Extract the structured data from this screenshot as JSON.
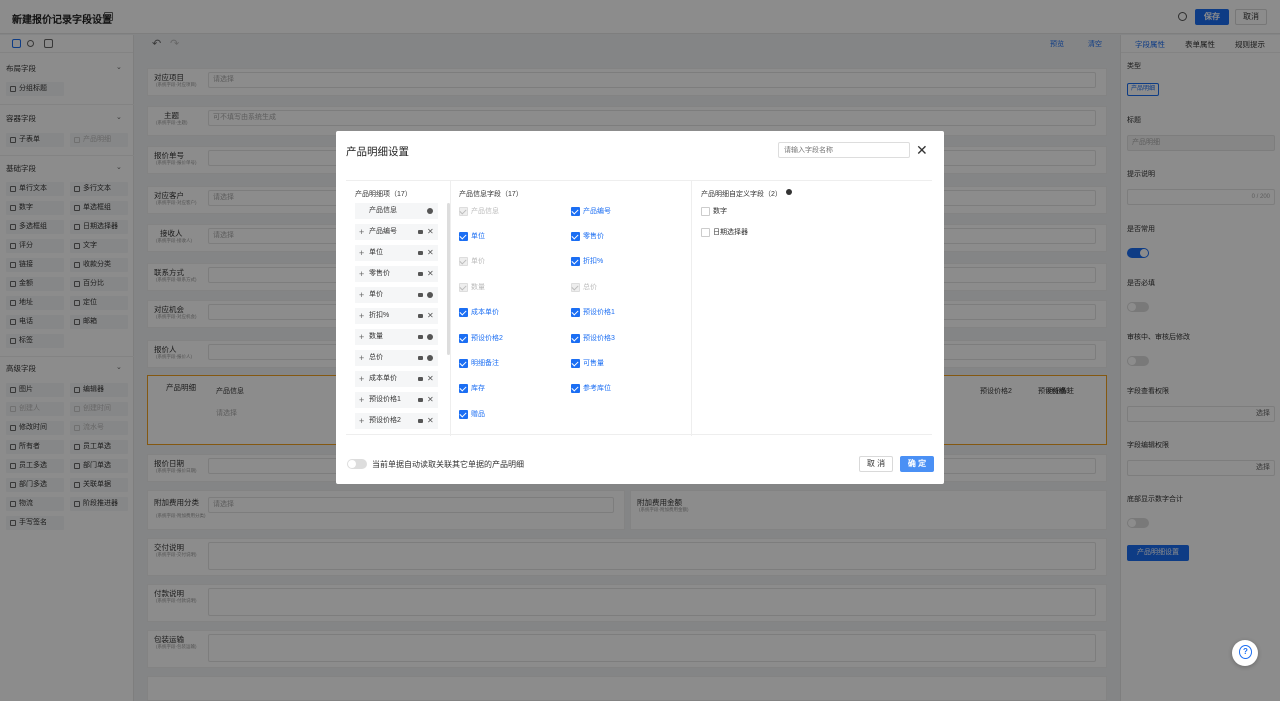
{
  "header": {
    "title": "新建报价记录字段设置",
    "save": "保存",
    "cancel": "取消"
  },
  "left": {
    "layout_title": "布局字段",
    "layout_items": [
      "分组标题"
    ],
    "container_title": "容器字段",
    "container_items": [
      "子表单",
      "产品明细"
    ],
    "basic_title": "基础字段",
    "basic_items": [
      "单行文本",
      "多行文本",
      "数字",
      "单选框组",
      "多选框组",
      "日期选择器",
      "评分",
      "文字",
      "链接",
      "收款分类",
      "金额",
      "百分比",
      "地址",
      "定位",
      "电话",
      "邮箱",
      "标签"
    ],
    "adv_title": "高级字段",
    "adv_items": [
      "图片",
      "编辑器",
      "创建人",
      "创建时间",
      "修改时间",
      "流水号",
      "所有者",
      "员工单选",
      "员工多选",
      "部门单选",
      "部门多选",
      "关联单据",
      "物流",
      "阶段推进器",
      "手写签名"
    ]
  },
  "form": {
    "rows": [
      {
        "label": "对应项目",
        "sub": "(系统字段-对应项目)",
        "value": "请选择"
      },
      {
        "label": "主题",
        "sub": "(系统字段-主题)",
        "value": "可不填写由系统生成"
      },
      {
        "label": "报价单号",
        "sub": "(系统字段-报价单号)",
        "value": ""
      },
      {
        "label": "对应客户",
        "sub": "(系统字段-对应客户)",
        "value": "请选择"
      },
      {
        "label": "接收人",
        "sub": "(系统字段-接收人)",
        "value": "请选择"
      },
      {
        "label": "联系方式",
        "sub": "(系统字段-联系方式)",
        "value": ""
      },
      {
        "label": "对应机会",
        "sub": "(系统字段-对应机会)",
        "value": ""
      },
      {
        "label": "报价人",
        "sub": "(系统字段-报价人)",
        "value": ""
      }
    ],
    "product_label": "产品明细",
    "product_info": "产品信息",
    "product_select": "请选择",
    "product_cols": [
      "预设价格2",
      "预设价格3",
      "明细备注"
    ],
    "rows2": [
      {
        "label": "报价日期",
        "sub": "(系统字段-报价日期)",
        "value": ""
      },
      {
        "label": "附加费用分类",
        "sub": "(系统字段-附加费用分类)",
        "value": "请选择"
      },
      {
        "label": "交付说明",
        "sub": "(系统字段-交付说明)",
        "value": ""
      },
      {
        "label": "付款说明",
        "sub": "(系统字段-付款说明)",
        "value": ""
      },
      {
        "label": "包装运输",
        "sub": "(系统字段-包装运输)",
        "value": ""
      }
    ],
    "extra_fee": "附加费用金额",
    "extra_fee_sub": "(系统字段-附加费用金额)"
  },
  "right": {
    "tabs": [
      "字段属性",
      "表单属性",
      "规则提示"
    ],
    "type_label": "类型",
    "type_value": "产品明细",
    "title_label": "标题",
    "title_value": "产品明细",
    "hint_label": "提示说明",
    "hint_count": "0 / 200",
    "common_label": "是否常用",
    "required_label": "是否必填",
    "edit_label": "审核中、审核后修改",
    "view_perm": "字段查看权限",
    "edit_perm": "字段编辑权限",
    "select": "选择",
    "sum_label": "底部显示数字合计",
    "settings_btn": "产品明细设置"
  },
  "center_toolbar": {
    "preview": "预览",
    "clear": "清空"
  },
  "modal": {
    "title": "产品明细设置",
    "search_placeholder": "请输入字段名称",
    "col1_title": "产品明细项（17）",
    "col2_title": "产品信息字段（17）",
    "col3_title": "产品明细自定义字段（2）",
    "list": [
      "产品信息",
      "产品编号",
      "单位",
      "零售价",
      "单价",
      "折扣%",
      "数量",
      "总价",
      "成本单价",
      "预设价格1",
      "预设价格2"
    ],
    "fields_left": [
      "产品信息",
      "单位",
      "单价",
      "数量",
      "成本单价",
      "预设价格2",
      "明细备注",
      "库存",
      "赠品"
    ],
    "fields_right": [
      "产品编号",
      "零售价",
      "折扣%",
      "总价",
      "预设价格1",
      "预设价格3",
      "可售量",
      "参考库位"
    ],
    "custom": [
      "数字",
      "日期选择器"
    ],
    "footer_text": "当前单据自动读取关联其它单据的产品明细",
    "cancel": "取 消",
    "ok": "确 定"
  }
}
